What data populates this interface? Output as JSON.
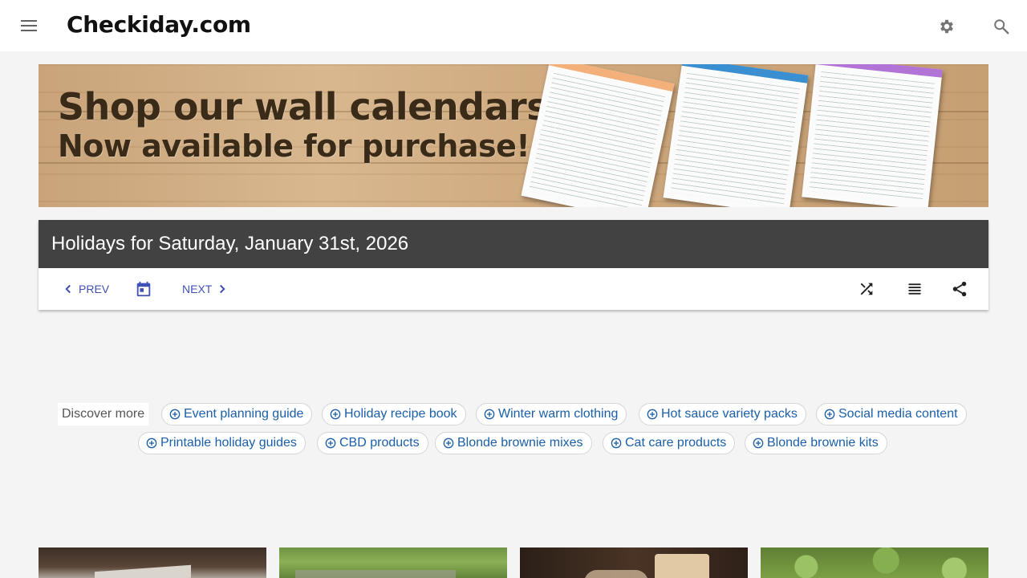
{
  "app": {
    "brand": "Checkiday.com"
  },
  "icons": {
    "menu": "menu-icon",
    "settings": "gear-icon",
    "search": "search-icon",
    "prev": "chevron-left-icon",
    "calendar": "calendar-icon",
    "next": "chevron-right-icon",
    "shuffle": "shuffle-icon",
    "list": "list-icon",
    "share": "share-icon",
    "chip": "plus-circle-icon"
  },
  "banner": {
    "line1": "Shop our wall calendars",
    "line2": "Now available for purchase!"
  },
  "day": {
    "title": "Holidays for Saturday, January 31st, 2026",
    "prev_label": "PREV",
    "next_label": "NEXT"
  },
  "discover": {
    "label": "Discover more",
    "chips": [
      "Event planning guide",
      "Holiday recipe book",
      "Winter warm clothing",
      "Hot sauce variety packs",
      "Social media content",
      "Printable holiday guides",
      "CBD products",
      "Blonde brownie mixes",
      "Cat care products",
      "Blonde brownie kits"
    ]
  },
  "colors": {
    "title_bar": "#424242",
    "nav_accent": "#3f51b5",
    "chip_text": "#1a5fa8",
    "page_bg": "#f4f4f4"
  }
}
